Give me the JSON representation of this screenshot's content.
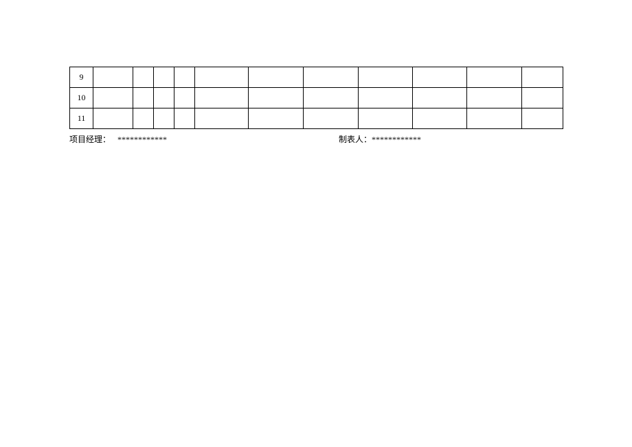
{
  "table": {
    "rows": [
      {
        "num": "9",
        "cells": [
          "",
          "",
          "",
          "",
          "",
          "",
          "",
          "",
          "",
          "",
          ""
        ]
      },
      {
        "num": "10",
        "cells": [
          "",
          "",
          "",
          "",
          "",
          "",
          "",
          "",
          "",
          "",
          ""
        ]
      },
      {
        "num": "11",
        "cells": [
          "",
          "",
          "",
          "",
          "",
          "",
          "",
          "",
          "",
          "",
          ""
        ]
      }
    ]
  },
  "footer": {
    "pm_label": "项目经理：",
    "pm_value": "************",
    "preparer_label": "制表人：",
    "preparer_value": "************"
  }
}
